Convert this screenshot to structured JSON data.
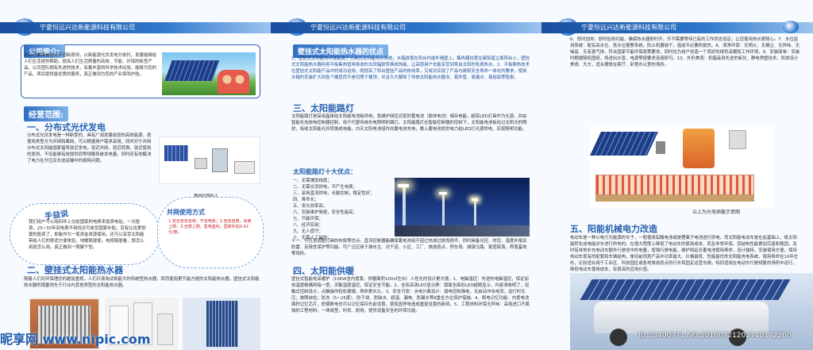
{
  "company": "宁夏恒远兴达新能源科技有限公司",
  "p1": {
    "intro_title": "公司简介:",
    "intro_text": "本公司秉持诚信公平创新原则，以新能源光伏发电为依托，发展能够给人们生活提供帮助，提高人们生活质量的高效、节能、环保的新型产品。公司团队拥有先进的技术，有着丰富的科学技术经验，能够为您的产品、项目提供最优质的服务，真正做到为您的产业保驾护航。",
    "scope_title": "经营范围:",
    "s1_title": "一、分布式光伏发电",
    "s1_text": "分布式光伏发电是一种新型的、具有广阔发展前景的高效能源，按使用类型分为并网和离网，可以根据用户需求采用，同时对于并网分布式太阳能国家倡导就近发电，就近并网，就近转换，就近使用的原则，不仅能够有效提供同等规模系统发电量，同时还有效解决了电力在升压及长途运输中的损耗问题。",
    "fig1_caption": "离网原理图-1",
    "shouyi_title": "手益说",
    "shouyi_text": "我们用户可以用四年上交给国家的电费来投资电站，一次投资，25~30年间电费不用找还可收受国家补贴，没有比这更划算的投资了，即能作为一笔资金来源使用，还可以享受太阳能带给人们的舒适方便体验，地暖随便使，电视随便看，想怎么用就怎么用，真正做到一照解千愁。",
    "bingwang_title": "并网使用方式",
    "bingwang_text": "1.完全自发自用，节省电费；2.自发自用，余量上网；3.全部上网，售电盈利。国家补贴0.42元/度。",
    "s2_title": "二、壁挂式太阳能热水器",
    "s2_text": "随着人们对环保理念的越加重视，人们日渐淘汰耗能大的传统型热水器，转而使用更节能方便的太阳能热水器，壁挂式太阳能热水器的销量领先于行业内其他类型的太阳能热水器。",
    "watermark": "昵享网 www.nipic.com"
  },
  "p2": {
    "adv_title": "壁挂式太阳能热水器的优点",
    "adv_text": "1、壁挂式太阳能热水器能属于分离式太阳能热水系统，水箱放置在阳台内或外墙壁上，集热器挂置在建筑南立面阳台上，壁挂式太阳能热水器利用平板集热管将吸收的太阳辐射转换成热能，让高层用户也能享受到来自太阳的免费热水。2、平板换热技术在壁挂式太阳能产品中的成功运用，既提高了阳台壁挂产品的热效率，又成功实现了产品与建筑安全寿命一体化的要求，使用水箱的安装扩大到各个楼层而不是仅限于楼顶，并且大大解除了传统太阳能热水器冻、易炸管、易漏水、易结垢等隐患。",
    "s3_title": "三、太阳能路灯",
    "s3_text": "太阳能路灯是采用晶体硅太阳能电池板供电，免维护阀控式密封蓄电池（胶体电池）储存电能，超亮LED灯具作为光源，并由智能化充放电控制器控制，用于代替传统市电照明的路灯。太阳能路灯在智能控制器的控制下，太阳能电池板经过太阳光的照射，吸收太阳能光并转换成电能，白天太阳电池组件向蓄电池充电，晚上蓄电池提供电力给LED灯光源供电，实现照明功能。",
    "adv10_title": "太阳能路灯十大优点：",
    "adv10_items": [
      "一、无需铺设线缆；",
      "二、无需交流供电，不产生电费；",
      "三、采用直流供电，光敏控制，稳定性好；",
      "四、寿命长；",
      "五、发光效率高；",
      "六、安装维护简便，安全性能高；",
      "七、节能环保；",
      "八、经济实用；",
      "九、无人值守；",
      "十、无需人工操作；"
    ],
    "adv10_text": "十一、可任意调整灯具的布局等优点。直流控制器能确保蓄电池组不因过充或过放而损坏，同时具备光控、时控、温度补偿及防雷、反极性保护等功能。可广泛应用于城市主、次干道、小区、工厂、旅游景点、停车场、城镇马路、家庭院落、养殖基地等场所。",
    "s4_title": "四、太阳能供暖",
    "s4_text": "壁挂式智能电采暖炉（10KW含内置泵，供暖面积100㎡左右）人性化的设计更方便。1、电脑温控：先进的电脑温控，保证加热温度精确到每一度，灵敏温度温控，保证安全节能。2、全彩高清LED显示屏：镜面全面彩LED超精显示，内容清晰明了，轻触式控制设计，点触操作轻松便捷，寿命更长久。3、安全可靠：水电分离设计：弱电控制强电，无启动冲击电流；运行时无压；故障自检；防冻（5~25度）、防干烧、防缺水、超温、漏电、防漏水等8重全方位保护措施。4、断电记忆功能：内置电池面积记忆芯片，即使断电也可以记忆保存先前设置，避免因停电造成重复设置的麻烦。5、工程材料环保无异味：采用进口不腐蚀的工程材料，一体成型，时尚、耐用，提供设备安全的环保功能。"
  },
  "p3": {
    "items_text": "6、即时加热：即时加热功能，确保热水器即时开，开不需要等待已有的工作状态设定，让您使用热水更随心。7、水位监测系统：配有高水位、低水位报警系统，防止机器烧干，造成不必要的损失。8、清净环保：无明火、无烟尘、无异味、无噪音、无有害气体，符合国家节能环保政策要求，同时也为用户创造一个良好的绿色采暖和工作环境。9、安装简单：安装时根据随机图纸，将进出水管、电源等按要求连接即可。10、外形美观：机箱采用先进的氧化、静电喷塑技术，机体设计美观、大方，适合摆放在客厅、卧室办公室的场所。",
    "diagram_caption": "以上为光电供暖示意图",
    "s5_title": "五、阳能机械电力改造",
    "s5_text": "电动车是一种以电力为能源的车子，一般使用铅酸电池或是锂离子电池进行供电。而太阳能电动车是在此基础上，将太阳能转化成电能对车进行供电的。在很大程度上降低了电动车的使用成本，而且非常环保。其结构性能更加完善和稳固，及时有效地补充电动车额外行驶途中的电量，增强行驶电能，维护和延长蓄电池使用寿命，设计独特，安装使用方便，保持电动车现有的配置和车辆结构，是目前同类产品中功率最大、价格最低、性能最优的太阳能充电系统，使用寿命在10年左右，比较适合用于工业区、科技园区或各地旅游景点的行车和固定运营车辆，特别适用在电动车行驶频繁的场所中运行，降低电动车使用成本，有很高的应用价值。",
    "watermark_id": "ID:23400971 NO:20160721202740172260"
  }
}
